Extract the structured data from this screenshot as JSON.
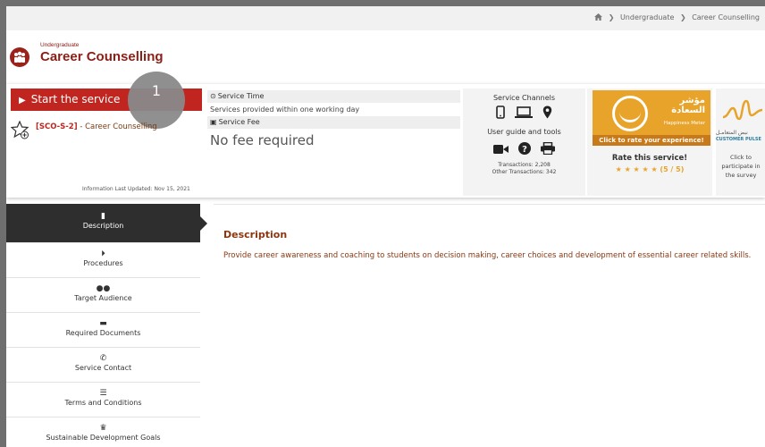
{
  "breadcrumb": {
    "items": [
      "Undergraduate",
      "Career Counselling"
    ],
    "home_icon": "home-icon"
  },
  "brand": {
    "subtitle": "Undergraduate",
    "title": "Career Counselling"
  },
  "service": {
    "start_label": "Start the service",
    "step_badge": "1",
    "code": "[SCO-S-2]",
    "code_name": "- Career Counselling",
    "updated": "Information Last Updated: Nov 15, 2021"
  },
  "time_fee": {
    "time_label": "Service Time",
    "time_value": "Services provided within one working day",
    "fee_label": "Service Fee",
    "fee_value": "No fee required"
  },
  "channels": {
    "title": "Service Channels",
    "guide_title": "User guide and tools",
    "transactions": "Transactions: 2,208",
    "other_transactions": "Other Transactions: 342"
  },
  "happiness": {
    "arabic_title": "مؤشر السعادة",
    "english_title": "Happiness Meter",
    "cta": "Click to rate your experience!",
    "rate_label": "Rate this service!",
    "stars": "★ ★ ★ ★ ★",
    "score": "(5 / 5)"
  },
  "pulse": {
    "arabic": "نبض المتعامـل",
    "english": "CUSTOMER PULSE",
    "cta": "Click to participate in the survey"
  },
  "sidebar": {
    "items": [
      {
        "label": "Description",
        "icon": "file-icon"
      },
      {
        "label": "Procedures",
        "icon": "step-icon"
      },
      {
        "label": "Target Audience",
        "icon": "users-icon"
      },
      {
        "label": "Required Documents",
        "icon": "folder-icon"
      },
      {
        "label": "Service Contact",
        "icon": "phone-icon"
      },
      {
        "label": "Terms and Conditions",
        "icon": "list-icon"
      },
      {
        "label": "Sustainable Development Goals",
        "icon": "trophy-icon"
      }
    ]
  },
  "content": {
    "title": "Description",
    "text": "Provide career awareness and coaching to students on decision making, career choices and development of essential career related skills."
  },
  "colors": {
    "brand_red": "#c0261f",
    "brown_text": "#8a3610",
    "happiness_orange": "#e8a32a"
  }
}
